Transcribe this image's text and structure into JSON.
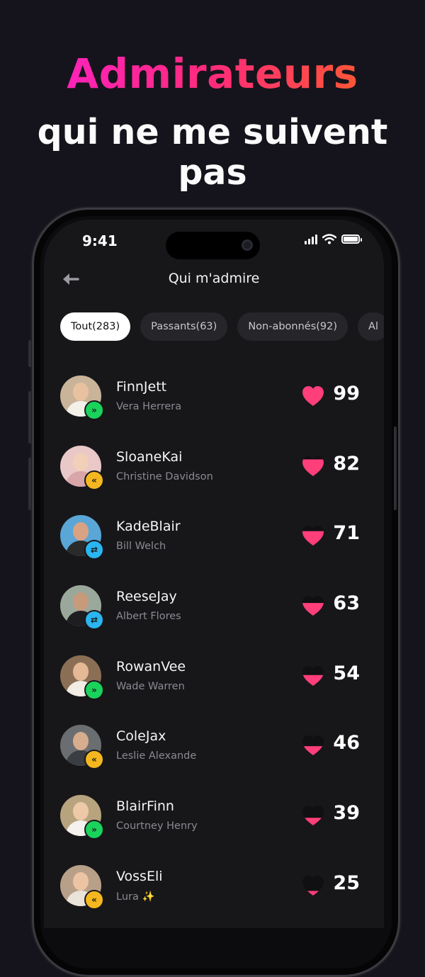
{
  "headline": {
    "line1": "Admirateurs",
    "line2": "qui ne me suivent pas"
  },
  "status": {
    "time": "9:41"
  },
  "nav": {
    "title": "Qui m'admire"
  },
  "tabs": [
    {
      "label": "Tout(283)",
      "active": true
    },
    {
      "label": "Passants(63)",
      "active": false
    },
    {
      "label": "Non-abonnés(92)",
      "active": false
    },
    {
      "label": "Al",
      "active": false
    }
  ],
  "users": [
    {
      "username": "FinnJett",
      "name": "Vera Herrera",
      "score": "99",
      "badge": "»",
      "badge_color": "#19d35b",
      "fill": 1.0,
      "avatar_bg": "#c9b49a",
      "avatar_skin": "#e8c2a0",
      "avatar_cloth": "#f3f0ea"
    },
    {
      "username": "SloaneKai",
      "name": "Christine Davidson",
      "score": "82",
      "badge": "«",
      "badge_color": "#f5b71f",
      "fill": 0.82,
      "avatar_bg": "#e9c8c7",
      "avatar_skin": "#f1cfb8",
      "avatar_cloth": "#d8a5a8"
    },
    {
      "username": "KadeBlair",
      "name": "Bill Welch",
      "score": "71",
      "badge": "⇄",
      "badge_color": "#2ab6f0",
      "fill": 0.71,
      "avatar_bg": "#5aa6d6",
      "avatar_skin": "#d9a383",
      "avatar_cloth": "#2a2a2a"
    },
    {
      "username": "ReeseJay",
      "name": "Albert Flores",
      "score": "63",
      "badge": "⇄",
      "badge_color": "#2ab6f0",
      "fill": 0.63,
      "avatar_bg": "#9aa89b",
      "avatar_skin": "#c79a7c",
      "avatar_cloth": "#1e1e22"
    },
    {
      "username": "RowanVee",
      "name": "Wade Warren",
      "score": "54",
      "badge": "»",
      "badge_color": "#19d35b",
      "fill": 0.54,
      "avatar_bg": "#8a6f55",
      "avatar_skin": "#e5b996",
      "avatar_cloth": "#f1ece4"
    },
    {
      "username": "ColeJax",
      "name": "Leslie Alexande",
      "score": "46",
      "badge": "«",
      "badge_color": "#f5b71f",
      "fill": 0.46,
      "avatar_bg": "#6b6e70",
      "avatar_skin": "#d6ad8f",
      "avatar_cloth": "#3a3d41"
    },
    {
      "username": "BlairFinn",
      "name": "Courtney Henry",
      "score": "39",
      "badge": "»",
      "badge_color": "#19d35b",
      "fill": 0.39,
      "avatar_bg": "#b7a47e",
      "avatar_skin": "#edc9a8",
      "avatar_cloth": "#f4f1ee"
    },
    {
      "username": "VossEli",
      "name": "Lura ✨",
      "score": "25",
      "badge": "«",
      "badge_color": "#f5b71f",
      "fill": 0.25,
      "avatar_bg": "#b8a088",
      "avatar_skin": "#edc4a3",
      "avatar_cloth": "#e9e3da"
    }
  ],
  "colors": {
    "heart": "#ff3f7a",
    "heart_empty": "#101012",
    "accent_start": "#ff1fd6",
    "accent_end": "#ff6a18"
  }
}
